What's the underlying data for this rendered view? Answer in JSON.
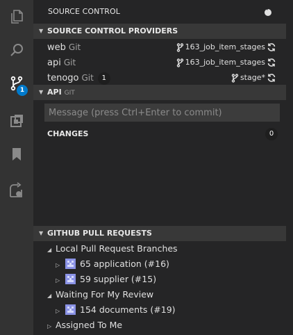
{
  "activity_bar": {
    "items": [
      {
        "icon": "files-icon"
      },
      {
        "icon": "search-icon"
      },
      {
        "icon": "source-control-icon",
        "badge": "1"
      },
      {
        "icon": "extensions-icon"
      },
      {
        "icon": "bookmark-icon"
      },
      {
        "icon": "remote-explorer-icon"
      }
    ]
  },
  "sidebar": {
    "title": "SOURCE CONTROL",
    "title_action_icon": "git-pull-icon"
  },
  "providers_section": {
    "title": "SOURCE CONTROL PROVIDERS",
    "rows": [
      {
        "name": "web",
        "type": "Git",
        "count": "",
        "branch": "163_job_item_stages"
      },
      {
        "name": "api",
        "type": "Git",
        "count": "",
        "branch": "163_job_item_stages"
      },
      {
        "name": "tenogo",
        "type": "Git",
        "count": "1",
        "branch": "stage*"
      }
    ]
  },
  "api_section": {
    "title": "API",
    "subtitle": "GIT",
    "commit_placeholder": "Message (press Ctrl+Enter to commit)",
    "commit_value": "",
    "changes_label": "CHANGES",
    "changes_count": "0"
  },
  "pr_section": {
    "title": "GITHUB PULL REQUESTS",
    "groups": [
      {
        "label": "Local Pull Request Branches",
        "expanded": true,
        "items": [
          "65 application (#16)",
          "59 supplier (#15)"
        ]
      },
      {
        "label": "Waiting For My Review",
        "expanded": true,
        "items": [
          "154 documents (#19)"
        ]
      },
      {
        "label": "Assigned To Me",
        "expanded": false,
        "items": []
      }
    ]
  },
  "colors": {
    "activity_bar": "#333333",
    "sidebar": "#252526",
    "section_header": "#383838",
    "accent_badge": "#007acc",
    "avatar": "#8b93e6"
  }
}
